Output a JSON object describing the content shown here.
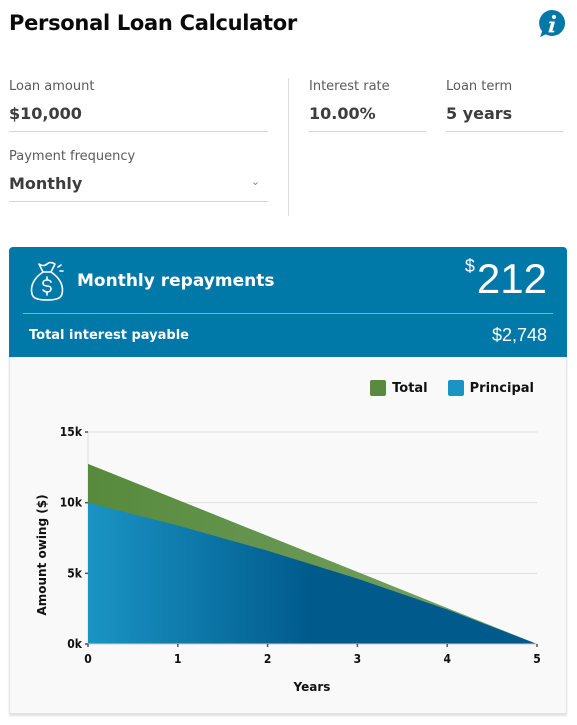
{
  "header": {
    "title": "Personal Loan Calculator",
    "info_icon": "info-speech-bubble-icon"
  },
  "form": {
    "loan_amount": {
      "label": "Loan amount",
      "value": "$10,000"
    },
    "interest_rate": {
      "label": "Interest rate",
      "value": "10.00%"
    },
    "loan_term": {
      "label": "Loan term",
      "value": "5 years"
    },
    "payment_frequency": {
      "label": "Payment frequency",
      "value": "Monthly"
    }
  },
  "result": {
    "icon": "money-bag-icon",
    "repayment_label": "Monthly repayments",
    "currency_symbol": "$",
    "repayment_amount": "212",
    "interest_label": "Total interest payable",
    "interest_value": "$2,748"
  },
  "colors": {
    "brand": "#0078a8",
    "total": "#5b8a3f",
    "principal": "#1a94c4",
    "principal_dark": "#005a8c"
  },
  "chart_data": {
    "type": "area",
    "title": "",
    "xlabel": "Years",
    "ylabel": "Amount owing ($)",
    "x": [
      0,
      1,
      2,
      3,
      4,
      5
    ],
    "x_ticks": [
      "0",
      "1",
      "2",
      "3",
      "4",
      "5"
    ],
    "y_ticks": [
      "0k",
      "5k",
      "10k",
      "15k"
    ],
    "y_tick_values": [
      0,
      5000,
      10000,
      15000
    ],
    "xlim": [
      0,
      5
    ],
    "ylim": [
      0,
      15000
    ],
    "grid": true,
    "legend": "top-right",
    "series": [
      {
        "name": "Total",
        "values": [
          12748,
          10199,
          7649,
          5099,
          2550,
          0
        ]
      },
      {
        "name": "Principal",
        "values": [
          10000,
          8384,
          6598,
          4625,
          2445,
          0
        ]
      }
    ]
  }
}
